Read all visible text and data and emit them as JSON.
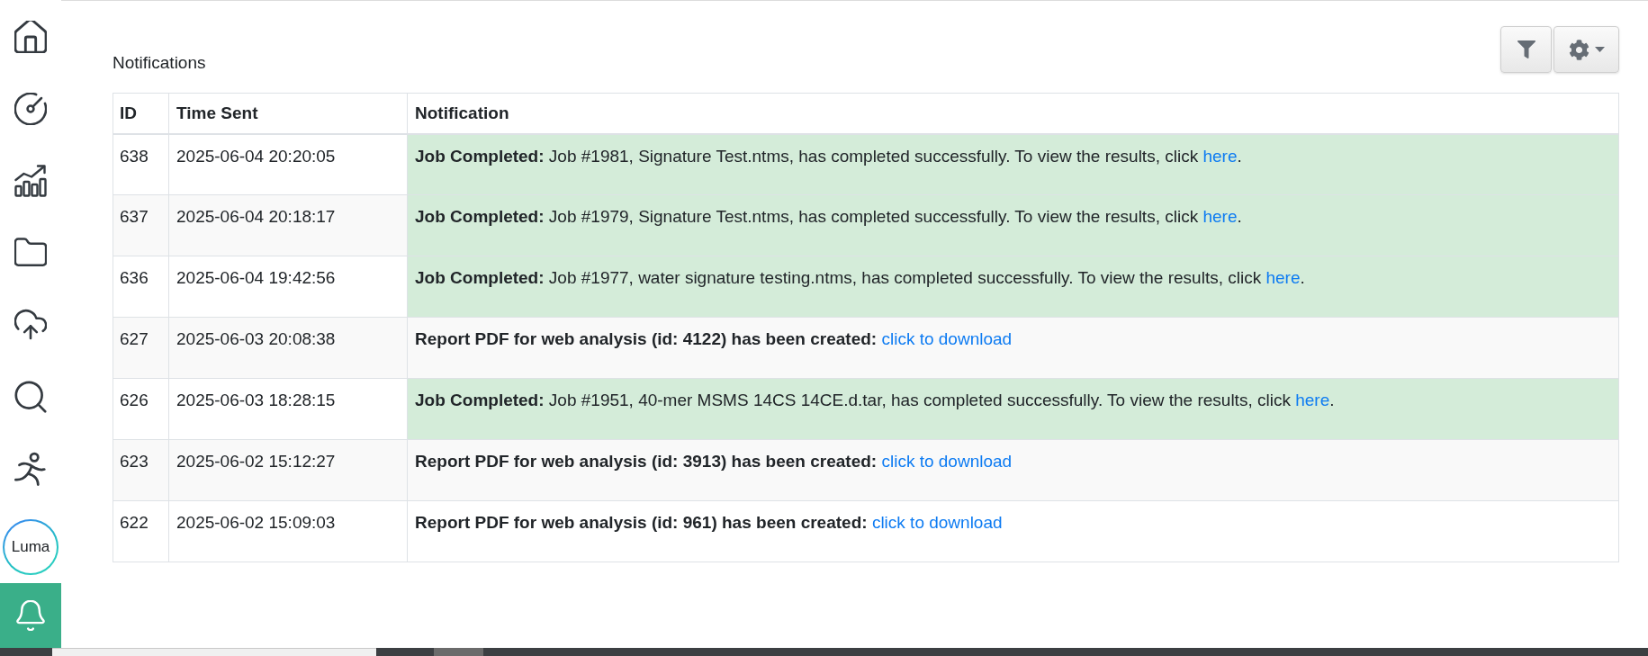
{
  "sidebar": {
    "items": [
      {
        "kind": "icon",
        "selected": false
      },
      {
        "kind": "icon",
        "selected": false
      },
      {
        "kind": "icon",
        "selected": false
      },
      {
        "kind": "icon",
        "selected": false
      },
      {
        "kind": "icon",
        "selected": false
      },
      {
        "kind": "icon",
        "selected": false
      },
      {
        "kind": "icon",
        "selected": false
      },
      {
        "kind": "logo",
        "label": "Luma",
        "selected": false
      },
      {
        "kind": "icon",
        "selected": true
      }
    ]
  },
  "page": {
    "title": "Notifications"
  },
  "table": {
    "columns": [
      "ID",
      "Time Sent",
      "Notification"
    ],
    "rows": [
      {
        "id": "638",
        "time_sent": "2025-06-04 20:20:05",
        "notification": {
          "kind": "job_completed",
          "text": "**Job Completed:** Job #1981, Signature Test.ntms, has completed successfully. To view the results, click",
          "link": "here",
          "after": "."
        }
      },
      {
        "id": "637",
        "time_sent": "2025-06-04 20:18:17",
        "notification": {
          "kind": "job_completed",
          "text": "**Job Completed:** Job #1979, Signature Test.ntms, has completed successfully. To view the results, click",
          "link": "here",
          "after": "."
        }
      },
      {
        "id": "636",
        "time_sent": "2025-06-04 19:42:56",
        "notification": {
          "kind": "job_completed",
          "text": "**Job Completed:** Job #1977, water signature testing.ntms, has completed successfully. To view the results, click",
          "link": "here",
          "after": "."
        }
      },
      {
        "id": "627",
        "time_sent": "2025-06-03 20:08:38",
        "notification": {
          "kind": "report_created",
          "text": "**Report PDF for web analysis (id: 4122) has been created:**",
          "link": "click to download"
        }
      },
      {
        "id": "626",
        "time_sent": "2025-06-03 18:28:15",
        "notification": {
          "kind": "job_completed",
          "text": "**Job Completed:** Job #1951, 40-mer MSMS 14CS 14CE.d.tar, has completed successfully. To view the results, click",
          "link": "here",
          "after": "."
        }
      },
      {
        "id": "623",
        "time_sent": "2025-06-02 15:12:27",
        "notification": {
          "kind": "report_created",
          "text": "**Report PDF for web analysis (id: 3913) has been created:**",
          "link": "click to download"
        }
      },
      {
        "id": "622",
        "time_sent": "2025-06-02 15:09:03",
        "notification": {
          "kind": "report_created",
          "text": "**Report PDF for web analysis (id: 961) has been created:**",
          "link": "click to download"
        }
      }
    ]
  }
}
